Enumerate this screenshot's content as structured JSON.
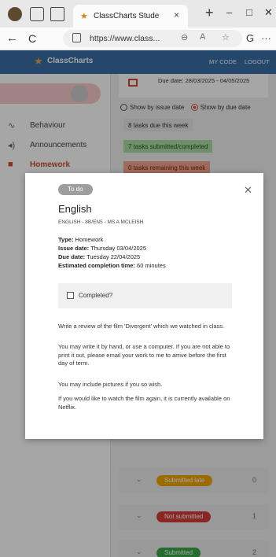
{
  "browser": {
    "tab_title": "ClassCharts Stude",
    "url": "https://www.class...",
    "new_tab": "+",
    "tab_close": "×",
    "win_min": "–",
    "win_max": "□",
    "win_close": "✕",
    "back": "←",
    "reload": "C",
    "more": "···"
  },
  "app": {
    "logo": "ClassCharts",
    "top_links": [
      "MY CODE",
      "LOGOUT"
    ],
    "sidebar": [
      {
        "label": "Behaviour",
        "icon": "trend-icon",
        "glyph": "∿"
      },
      {
        "label": "Announcements",
        "icon": "megaphone-icon",
        "glyph": "◂)"
      },
      {
        "label": "Homework",
        "icon": "briefcase-icon",
        "glyph": "■"
      }
    ],
    "due_range": "Due date: 28/03/2025 - 04/05/2025",
    "radio_issue": "Show by issue date",
    "radio_due": "Show by due date",
    "pill_due": "8 tasks due this week",
    "pill_submitted": "7 tasks submitted/completed",
    "pill_remaining": "0 tasks remaining this week",
    "accordions": [
      {
        "label": "Submitted late",
        "count": "0",
        "color": "#f0a500"
      },
      {
        "label": "Not submitted",
        "count": "1",
        "color": "#d63b3b"
      },
      {
        "label": "Submitted",
        "count": "2",
        "color": "#3aa64a"
      }
    ]
  },
  "modal": {
    "status": "To do",
    "subject": "English",
    "class": "ENGLISH - 8B/EN5 - MS A MCLEISH",
    "type_label": "Type:",
    "type_value": "Homework",
    "issue_label": "Issue date:",
    "issue_value": "Thursday 03/04/2025",
    "due_label": "Due date:",
    "due_value": "Tuesday 22/04/2025",
    "est_label": "Estimated completion time:",
    "est_value": "60 minutes",
    "completed_label": "Completed?",
    "paragraphs": [
      "Write a review of the film 'Divergent' which we watched in class.",
      "You may write it by hand, or use a computer. If you are not able to print it out, please email your work to me to arrive before the first day of term.",
      "You may include pictures if you so wish.",
      "If you would like to watch the film again, it is currently available on Netflix."
    ]
  }
}
